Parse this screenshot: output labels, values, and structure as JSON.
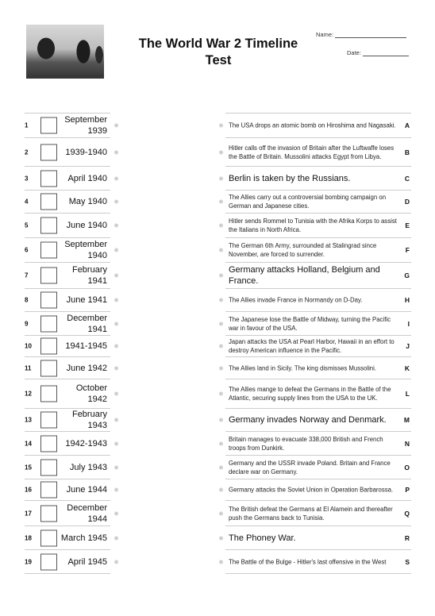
{
  "header": {
    "title": "The World War 2 Timeline Test",
    "name_label": "Name:",
    "date_label": "Date:",
    "image_alt": "soldiers-photo"
  },
  "dates": [
    {
      "num": "1",
      "label": "September 1939"
    },
    {
      "num": "2",
      "label": "1939-1940"
    },
    {
      "num": "3",
      "label": "April 1940"
    },
    {
      "num": "4",
      "label": "May 1940"
    },
    {
      "num": "5",
      "label": "June 1940"
    },
    {
      "num": "6",
      "label": "September 1940"
    },
    {
      "num": "7",
      "label": "February 1941"
    },
    {
      "num": "8",
      "label": "June 1941"
    },
    {
      "num": "9",
      "label": "December 1941"
    },
    {
      "num": "10",
      "label": "1941-1945"
    },
    {
      "num": "11",
      "label": "June 1942"
    },
    {
      "num": "12",
      "label": "October 1942"
    },
    {
      "num": "13",
      "label": "February 1943"
    },
    {
      "num": "14",
      "label": "1942-1943"
    },
    {
      "num": "15",
      "label": "July 1943"
    },
    {
      "num": "16",
      "label": "June 1944"
    },
    {
      "num": "17",
      "label": "December 1944"
    },
    {
      "num": "18",
      "label": "March 1945"
    },
    {
      "num": "19",
      "label": "April 1945"
    }
  ],
  "events": [
    {
      "letter": "A",
      "text": "The USA drops an atomic bomb on Hiroshima and Nagasaki.",
      "big": false
    },
    {
      "letter": "B",
      "text": "Hitler calls off the invasion of Britain after the Luftwaffe loses the Battle of Britain. Mussolini attacks Egypt from Libya.",
      "big": false
    },
    {
      "letter": "C",
      "text": "Berlin is taken by the Russians.",
      "big": true
    },
    {
      "letter": "D",
      "text": "The Allies carry out a controversial bombing campaign on German and Japanese cities.",
      "big": false
    },
    {
      "letter": "E",
      "text": "Hitler sends Rommel to Tunisia with the Afrika Korps to assist the Italians in North Africa.",
      "big": false
    },
    {
      "letter": "F",
      "text": "The German 6th Army, surrounded at Stalingrad since November, are forced to surrender.",
      "big": false
    },
    {
      "letter": "G",
      "text": "Germany attacks Holland, Belgium and France.",
      "big": true
    },
    {
      "letter": "H",
      "text": "The Allies invade France in Normandy on D-Day.",
      "big": false
    },
    {
      "letter": "I",
      "text": "The Japanese lose the Battle of Midway, turning the Pacific war in favour of the USA.",
      "big": false
    },
    {
      "letter": "J",
      "text": "Japan attacks the USA at Pearl Harbor, Hawaii in an effort to destroy American influence in the Pacific.",
      "big": false
    },
    {
      "letter": "K",
      "text": "The Allies land in Sicily. The king dismisses Mussolini.",
      "big": false
    },
    {
      "letter": "L",
      "text": "The Allies mange to defeat the Germans in the Battle of the Atlantic, securing supply lines from the USA to the UK.",
      "big": false
    },
    {
      "letter": "M",
      "text": "Germany invades Norway and Denmark.",
      "big": true
    },
    {
      "letter": "N",
      "text": "Britain manages to evacuate 338,000 British and French troops from Dunkirk.",
      "big": false
    },
    {
      "letter": "O",
      "text": "Germany and the USSR invade Poland. Britain and France declare war on Germany.",
      "big": false
    },
    {
      "letter": "P",
      "text": "Germany attacks the Soviet Union in Operation Barbarossa.",
      "big": false
    },
    {
      "letter": "Q",
      "text": "The British defeat the Germans at El Alamein and thereafter push the Germans back to Tunisia.",
      "big": false
    },
    {
      "letter": "R",
      "text": "The Phoney War.",
      "big": true
    },
    {
      "letter": "S",
      "text": "The Battle of the Bulge - Hitler's last offensive in the West",
      "big": false
    }
  ]
}
